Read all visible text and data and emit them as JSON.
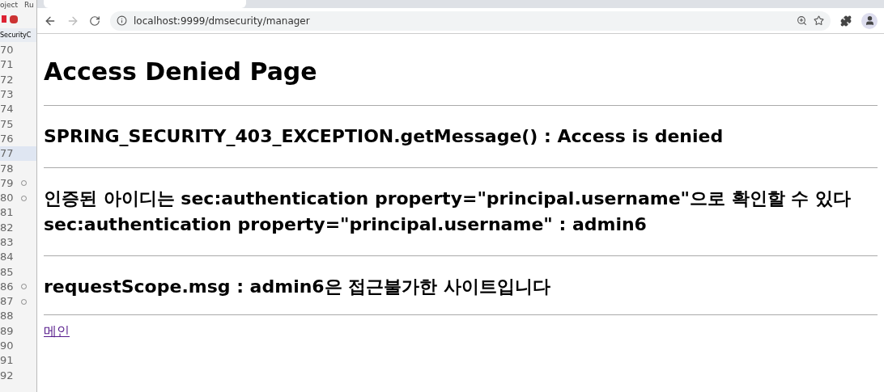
{
  "ide": {
    "menu": [
      "oject",
      "Ru"
    ],
    "editor_tab": "SecurityC",
    "lines": [
      {
        "number": "70",
        "fold": false,
        "selected": false
      },
      {
        "number": "71",
        "fold": false,
        "selected": false
      },
      {
        "number": "72",
        "fold": false,
        "selected": false
      },
      {
        "number": "73",
        "fold": false,
        "selected": false
      },
      {
        "number": "74",
        "fold": false,
        "selected": false
      },
      {
        "number": "75",
        "fold": false,
        "selected": false
      },
      {
        "number": "76",
        "fold": false,
        "selected": false
      },
      {
        "number": "77",
        "fold": false,
        "selected": true
      },
      {
        "number": "78",
        "fold": false,
        "selected": false
      },
      {
        "number": "79",
        "fold": true,
        "selected": false
      },
      {
        "number": "80",
        "fold": true,
        "selected": false
      },
      {
        "number": "81",
        "fold": false,
        "selected": false
      },
      {
        "number": "82",
        "fold": false,
        "selected": false
      },
      {
        "number": "83",
        "fold": false,
        "selected": false
      },
      {
        "number": "84",
        "fold": false,
        "selected": false
      },
      {
        "number": "85",
        "fold": false,
        "selected": false
      },
      {
        "number": "86",
        "fold": true,
        "selected": false
      },
      {
        "number": "87",
        "fold": true,
        "selected": false
      },
      {
        "number": "88",
        "fold": false,
        "selected": false
      },
      {
        "number": "89",
        "fold": false,
        "selected": false
      },
      {
        "number": "90",
        "fold": false,
        "selected": false
      },
      {
        "number": "91",
        "fold": false,
        "selected": false
      },
      {
        "number": "92",
        "fold": false,
        "selected": false
      }
    ]
  },
  "browser": {
    "url": "localhost:9999/dmsecurity/manager"
  },
  "page": {
    "title": "Access Denied Page",
    "sections": [
      {
        "lines": [
          "SPRING_SECURITY_403_EXCEPTION.getMessage() : Access is denied"
        ]
      },
      {
        "lines": [
          "인증된 아이디는 sec:authentication property=\"principal.username\"으로 확인할 수 있다",
          "sec:authentication property=\"principal.username\" : admin6"
        ]
      },
      {
        "lines": [
          "requestScope.msg : admin6은 접근불가한 사이트입니다"
        ]
      }
    ],
    "link": "메인"
  }
}
